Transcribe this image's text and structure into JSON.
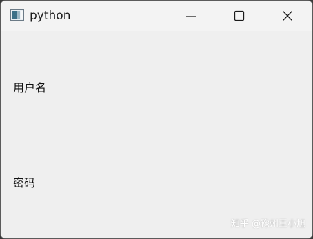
{
  "window": {
    "title": "python",
    "app_icon": "python-app-icon",
    "controls": {
      "minimize_icon": "minimize-icon",
      "maximize_icon": "maximize-icon",
      "close_icon": "close-icon"
    }
  },
  "form": {
    "username_label": "用户名",
    "password_label": "密码"
  },
  "watermark": "知乎 @豫州王小旭"
}
